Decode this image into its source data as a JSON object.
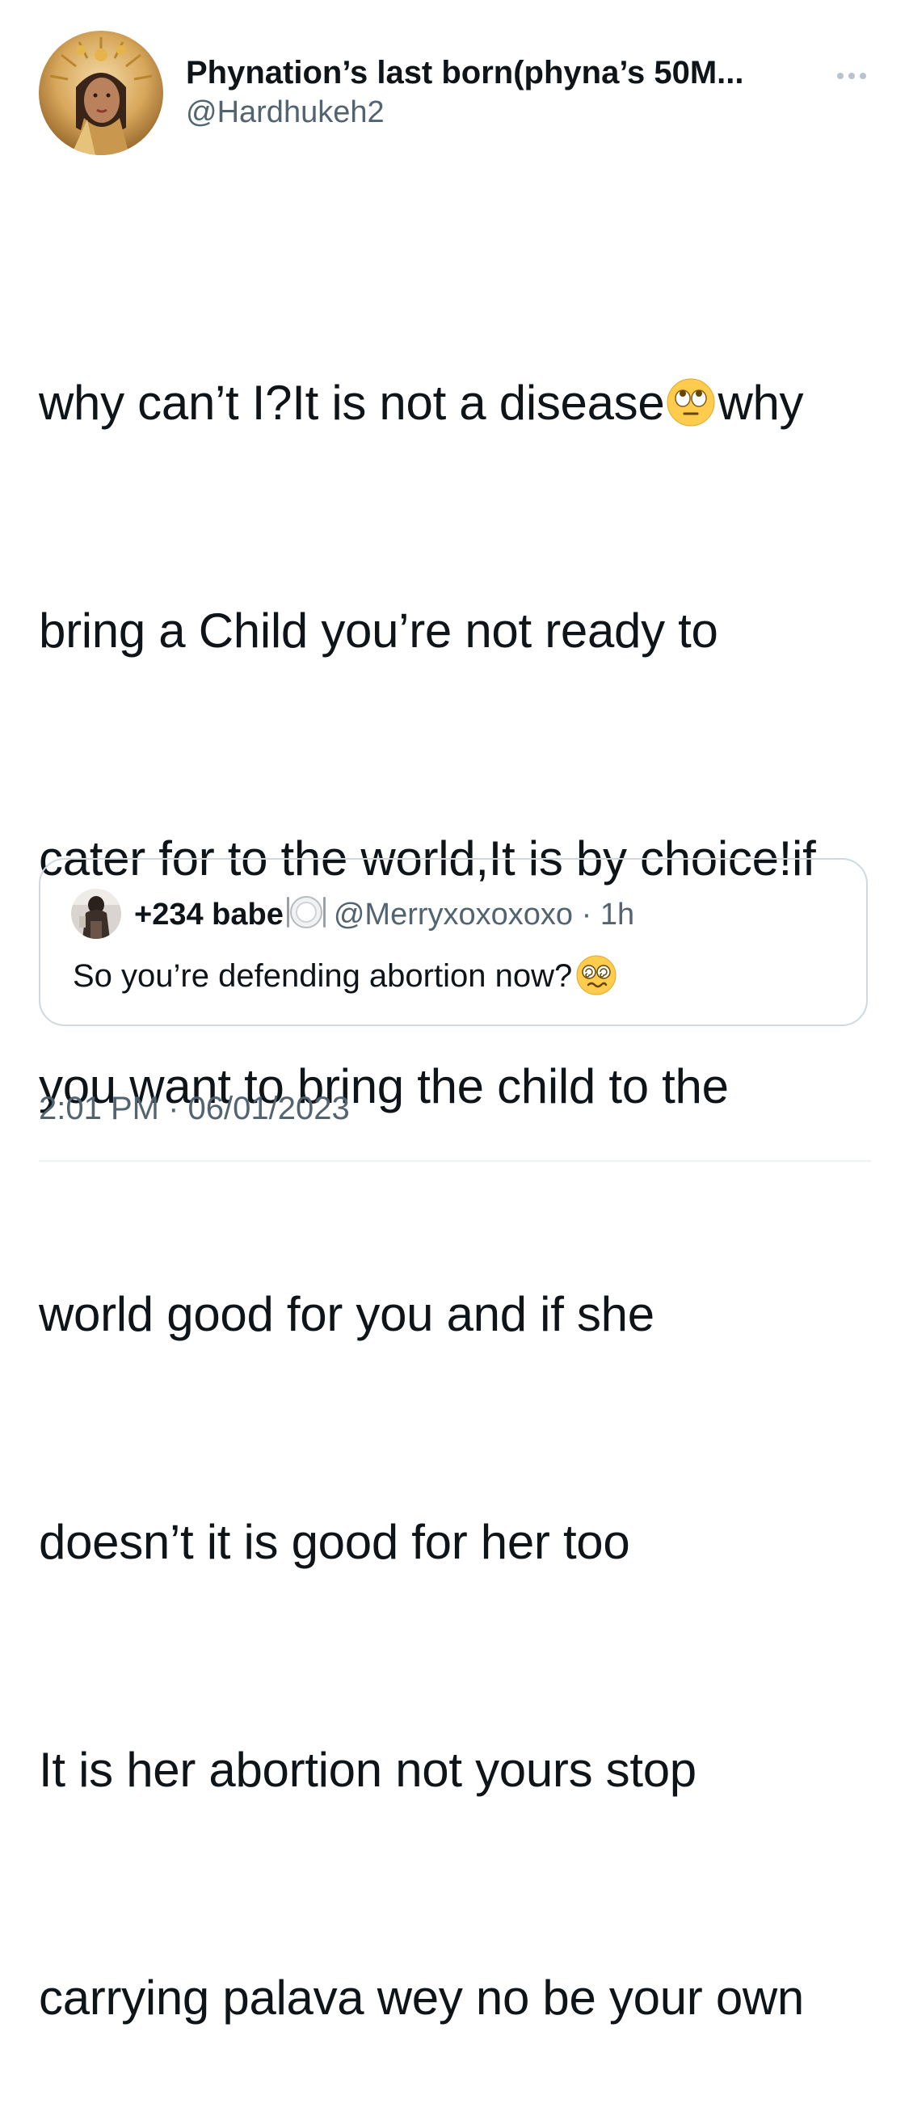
{
  "author": {
    "display_name": "Phynation’s last born(phyna’s 50M...",
    "handle": "@Hardhukeh2",
    "avatar_icon": "profile-photo-gold-crown"
  },
  "more_icon": "more-dots-icon",
  "tweet": {
    "lines": [
      {
        "before": "why can’t I?It is not a disease",
        "emoji": "face-with-rolling-eyes",
        "after": "why"
      },
      {
        "text": "bring a Child you’re not ready to"
      },
      {
        "text": "cater for to the world,It is by choice!if"
      },
      {
        "text": "you want to bring the child to the"
      },
      {
        "text": "world good for you and if she"
      },
      {
        "text": "doesn’t it is good for her too"
      },
      {
        "text": "It is her abortion not yours stop"
      },
      {
        "text": "carrying palava wey no be your own"
      }
    ]
  },
  "quoted_tweet": {
    "display_name": "+234 babe",
    "name_emoji": "fork-and-knife-with-plate",
    "handle": "@Merryxoxoxoxo",
    "separator": "·",
    "time": "1h",
    "text": "So you’re defending abortion now?",
    "text_emoji": "face-with-spiral-eyes"
  },
  "timestamp": {
    "time": "2:01 PM",
    "separator": "·",
    "date": "06/01/2023"
  },
  "colors": {
    "text": "#0f1419",
    "secondary": "#536471",
    "border": "#cfd9de",
    "emoji_yellow": "#ffcc4d"
  }
}
